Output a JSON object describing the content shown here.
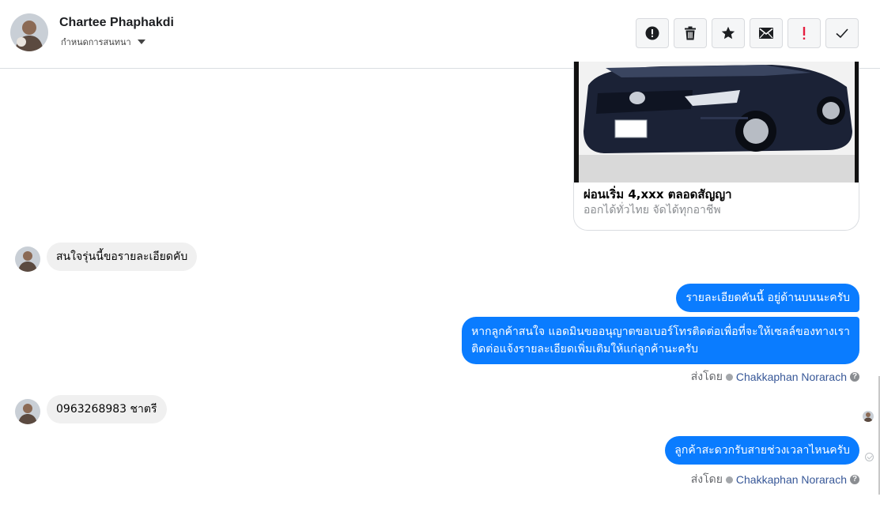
{
  "header": {
    "contact_name": "Chartee Phaphakdi",
    "subtitle": "กำหนดการสนทนา",
    "toolbar": [
      {
        "name": "report-icon",
        "label": "report"
      },
      {
        "name": "delete-icon",
        "label": "delete"
      },
      {
        "name": "star-icon",
        "label": "star"
      },
      {
        "name": "mail-icon",
        "label": "mark unread"
      },
      {
        "name": "priority-icon",
        "label": "priority"
      },
      {
        "name": "done-icon",
        "label": "done"
      }
    ]
  },
  "messages": {
    "card": {
      "title": "ผ่อนเริ่ม 4,xxx ตลอดสัญญา",
      "subtitle": "ออกได้ทั่วไทย จัดได้ทุกอาชีพ"
    },
    "incoming_1": "สนใจรุ่นนี้ขอรายละเอียดคับ",
    "outgoing_1": "รายละเอียดคันนี้ อยู่ด้านบนนะครับ",
    "outgoing_2_line1": "หากลูกค้าสนใจ แอดมินขออนุญาตขอเบอร์โทรติดต่อเพื่อที่จะให้เซลล์ของทางเรา",
    "outgoing_2_line2": "ติดต่อแจ้งรายละเอียดเพิ่มเติมให้แก่ลูกค้านะครับ",
    "sent_by_1": {
      "prefix": "ส่งโดย",
      "name": "Chakkaphan Norarach",
      "help": "?"
    },
    "incoming_2": "0963268983 ชาตรี",
    "outgoing_3": "ลูกค้าสะดวกรับสายช่วงเวลาไหนครับ",
    "sent_by_2": {
      "prefix": "ส่งโดย",
      "name": "Chakkaphan Norarach",
      "help": "?"
    }
  },
  "colors": {
    "outgoing_bubble": "#0a7cff",
    "incoming_bubble": "#f0f0f0",
    "sender_link": "#385898",
    "priority_red": "#e41e3f"
  }
}
